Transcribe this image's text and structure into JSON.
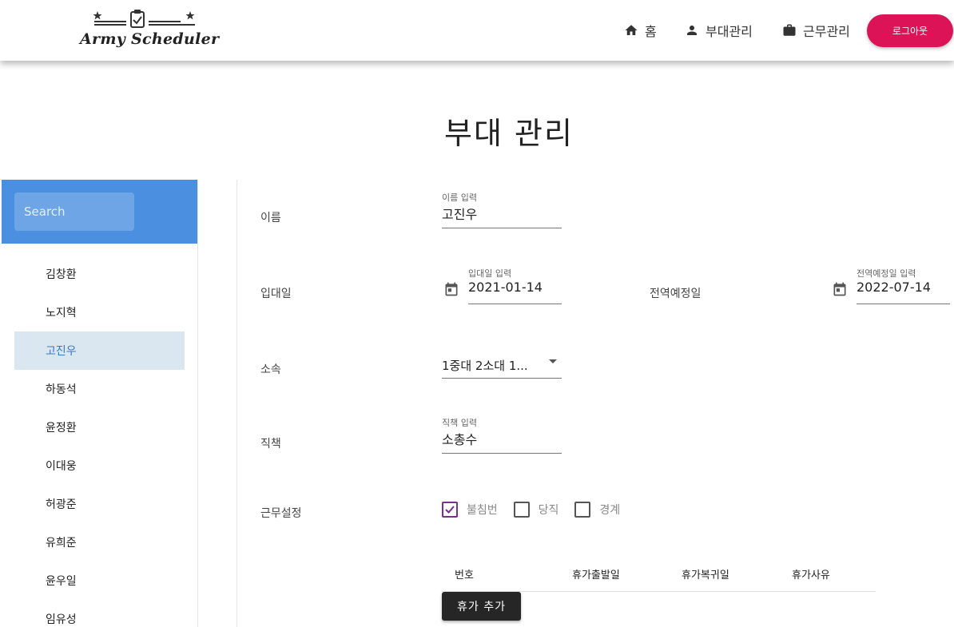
{
  "header": {
    "logo_text": "Army Scheduler",
    "nav": [
      {
        "label": "홈",
        "icon": "home-icon"
      },
      {
        "label": "부대관리",
        "icon": "person-icon"
      },
      {
        "label": "근무관리",
        "icon": "briefcase-icon"
      }
    ],
    "logout_label": "로그아웃"
  },
  "page_title": "부대 관리",
  "sidebar": {
    "search_placeholder": "Search",
    "soldiers": [
      "김창환",
      "노지혁",
      "고진우",
      "하동석",
      "윤정환",
      "이대웅",
      "허광준",
      "유희준",
      "윤우일",
      "임유성"
    ],
    "selected": "고진우"
  },
  "form": {
    "name": {
      "label": "이름",
      "hint": "이름 입력",
      "value": "고진우"
    },
    "enlist": {
      "label": "입대일",
      "hint": "입대일 입력",
      "value": "2021-01-14"
    },
    "discharge": {
      "label": "전역예정일",
      "hint": "전역예정일 입력",
      "value": "2022-07-14"
    },
    "unit": {
      "label": "소속",
      "value": "1중대 2소대 1..."
    },
    "position": {
      "label": "직책",
      "hint": "직책 입력",
      "value": "소총수"
    },
    "duty": {
      "label": "근무설정",
      "options": [
        {
          "label": "불침번",
          "checked": true
        },
        {
          "label": "당직",
          "checked": false
        },
        {
          "label": "경계",
          "checked": false
        }
      ]
    }
  },
  "leave_table": {
    "headers": [
      "번호",
      "휴가출발일",
      "휴가복귀일",
      "휴가사유"
    ],
    "rows": []
  },
  "add_leave_label": "휴가 추가",
  "colors": {
    "accent": "#4a8fe0",
    "logout": "#dc1356",
    "selected_bg": "#dbe7f0",
    "checkbox_checked": "#7c2d8f"
  }
}
